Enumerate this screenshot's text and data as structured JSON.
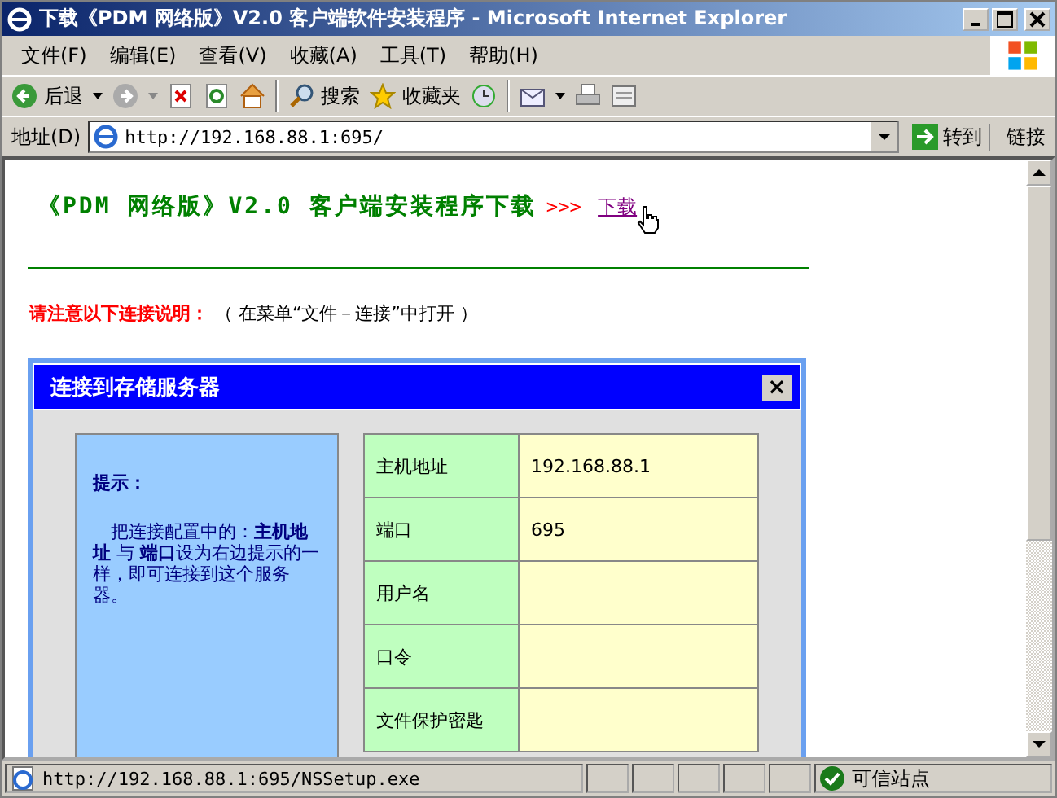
{
  "window": {
    "title": "下载《PDM 网络版》V2.0 客户端软件安装程序 - Microsoft Internet Explorer"
  },
  "menu": [
    "文件(F)",
    "编辑(E)",
    "查看(V)",
    "收藏(A)",
    "工具(T)",
    "帮助(H)"
  ],
  "toolbar": {
    "back": "后退",
    "search": "搜索",
    "favorites": "收藏夹"
  },
  "address": {
    "label": "地址(D)",
    "value": "http://192.168.88.1:695/",
    "go": "转到",
    "links": "链接"
  },
  "page": {
    "heading": "《PDM 网络版》V2.0 客户端安装程序下载",
    "arrows": ">>>",
    "link": "下载",
    "notice_label": "请注意以下连接说明：",
    "notice_text": "（ 在菜单“文件－连接”中打开 ）",
    "dialog": {
      "title": "连接到存储服务器",
      "close": "×",
      "tip_title": "提示：",
      "tip_text": "　把连接配置中的：**主机地址** 与 **端口**设为右边提示的一样，即可连接到这个服务器。",
      "fields": [
        {
          "label": "主机地址",
          "value": "192.168.88.1"
        },
        {
          "label": "端口",
          "value": "695"
        },
        {
          "label": "用户名"
        },
        {
          "label": "口令"
        },
        {
          "label": "文件保护密匙"
        }
      ]
    }
  },
  "status_bar": {
    "text": "http://192.168.88.1:695/NSSetup.exe",
    "zone": "可信站点"
  }
}
